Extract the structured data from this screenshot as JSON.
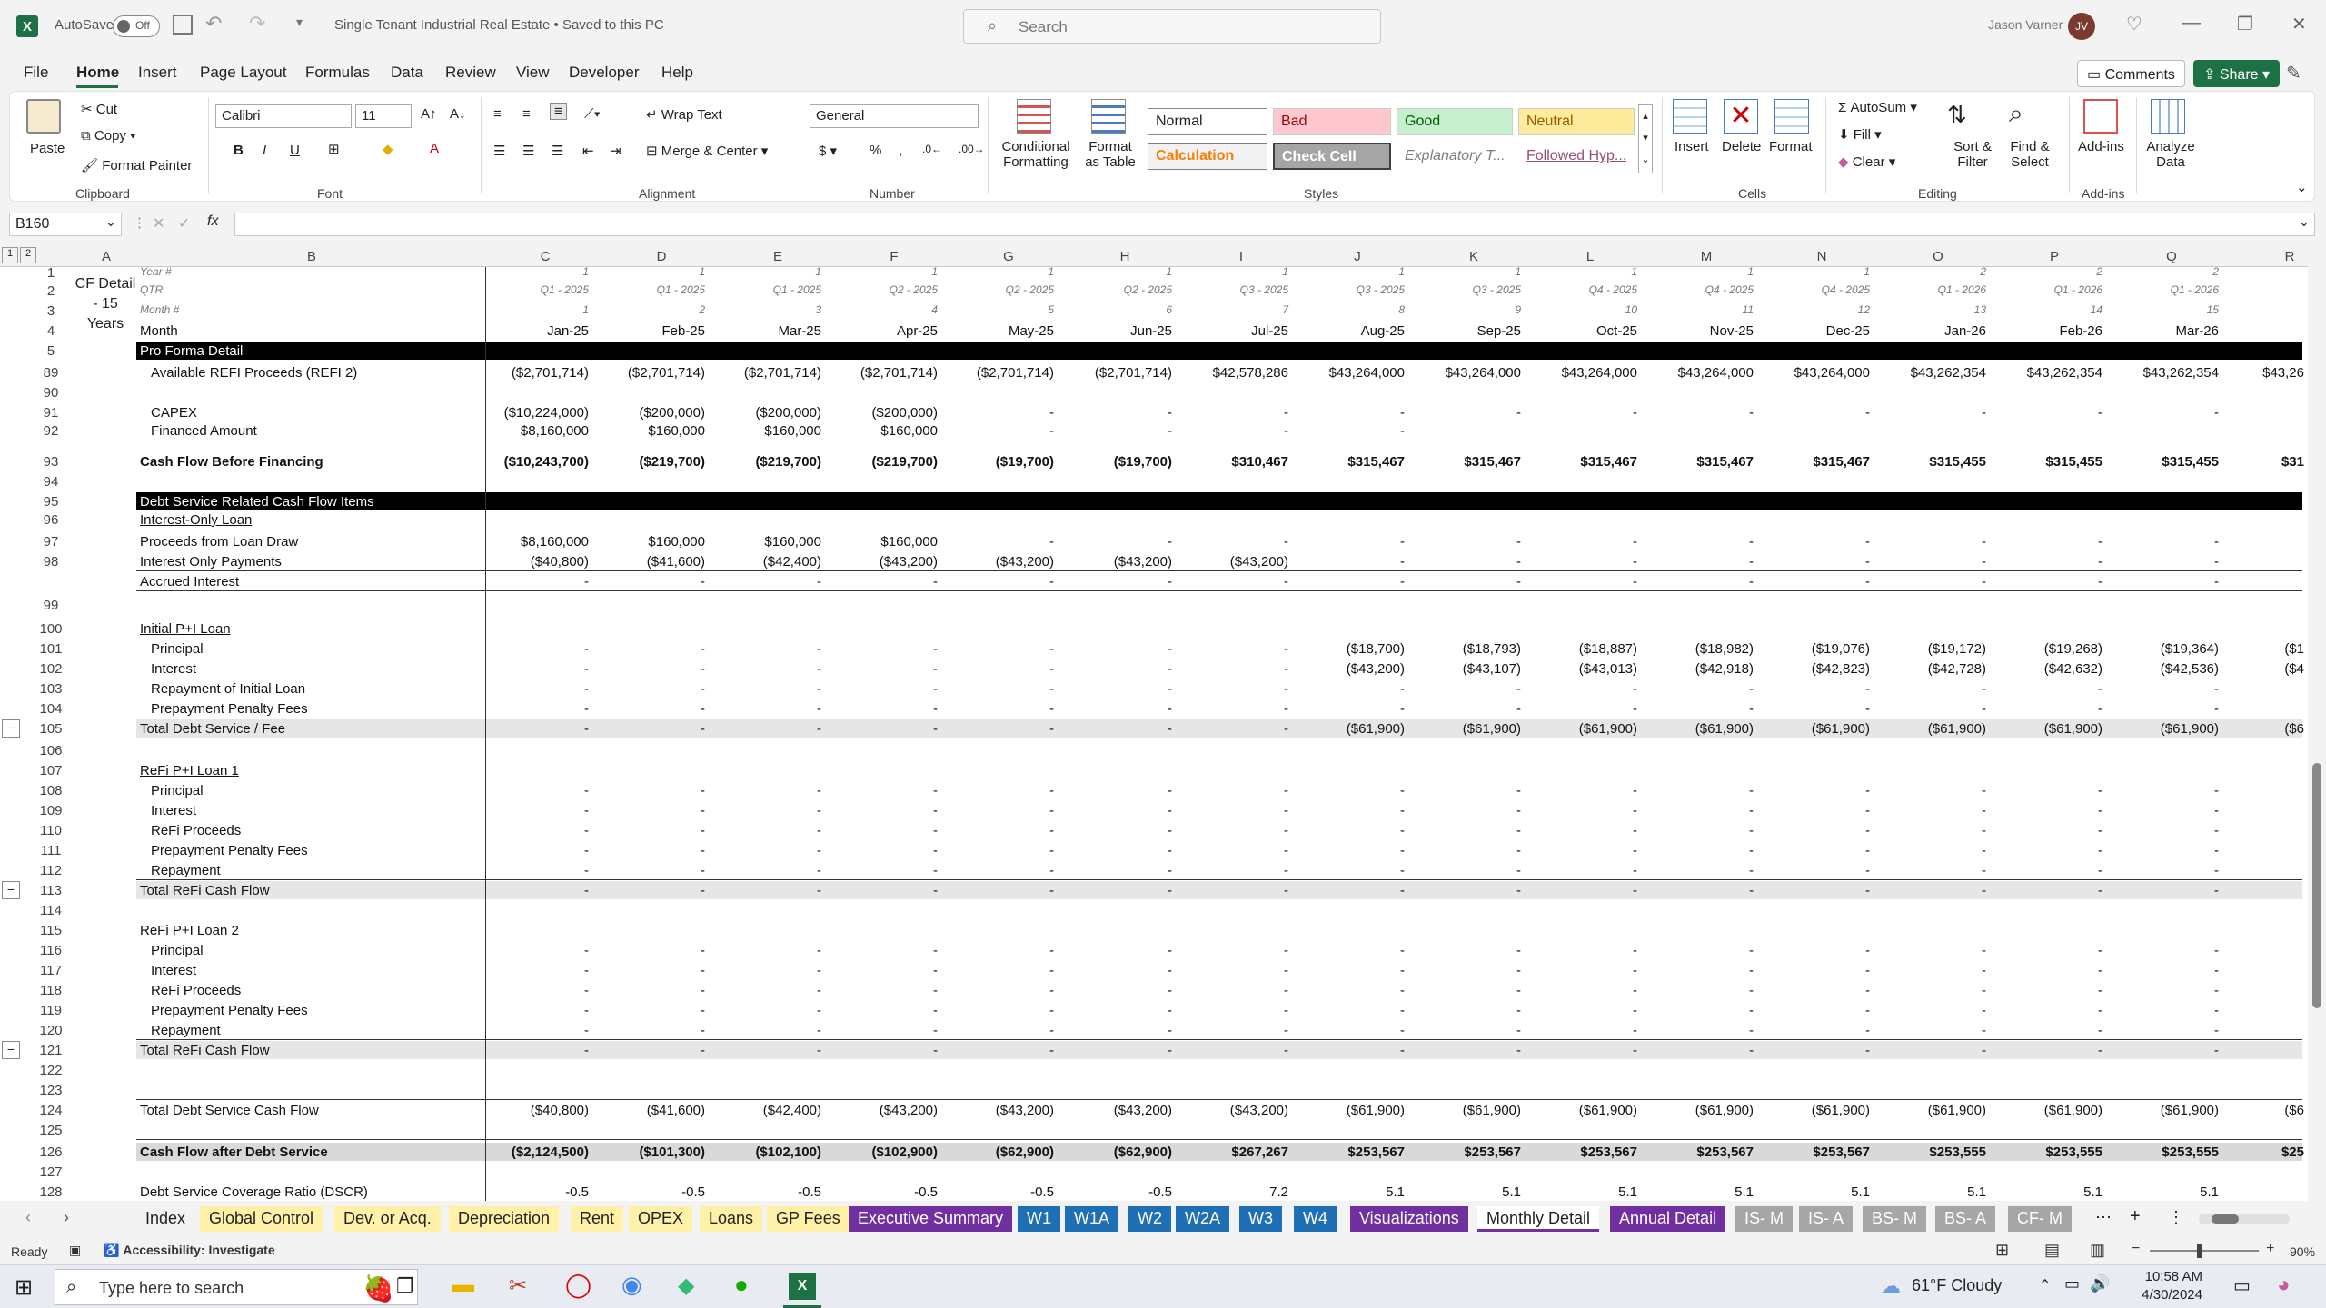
{
  "titlebar": {
    "autosave_label": "AutoSave",
    "autosave_state": "Off",
    "doc_title": "Single Tenant Industrial Real Estate • Saved to this PC",
    "search_placeholder": "Search",
    "user_name": "Jason Varner",
    "user_initials": "JV"
  },
  "menu": [
    "File",
    "Home",
    "Insert",
    "Page Layout",
    "Formulas",
    "Data",
    "Review",
    "View",
    "Developer",
    "Help"
  ],
  "menu_active": "Home",
  "comments_label": "Comments",
  "share_label": "Share",
  "ribbon": {
    "clipboard": {
      "paste": "Paste",
      "cut": "Cut",
      "copy": "Copy",
      "format_painter": "Format Painter",
      "group": "Clipboard"
    },
    "font": {
      "name": "Calibri",
      "size": "11",
      "group": "Font"
    },
    "alignment": {
      "wrap": "Wrap Text",
      "merge": "Merge & Center",
      "group": "Alignment"
    },
    "number": {
      "format": "General",
      "group": "Number"
    },
    "styles": {
      "conditional": "Conditional Formatting",
      "format_table": "Format as Table",
      "cells": [
        "Normal",
        "Bad",
        "Good",
        "Neutral",
        "Calculation",
        "Check Cell",
        "Explanatory T...",
        "Followed Hyp..."
      ],
      "group": "Styles"
    },
    "cells": {
      "insert": "Insert",
      "delete": "Delete",
      "format": "Format",
      "group": "Cells"
    },
    "editing": {
      "autosum": "AutoSum",
      "fill": "Fill",
      "clear": "Clear",
      "sort": "Sort & Filter",
      "find": "Find & Select",
      "group": "Editing"
    },
    "addins": {
      "addins": "Add-ins",
      "analyze": "Analyze Data",
      "group": "Add-ins"
    }
  },
  "formula": {
    "namebox": "B160",
    "fx": "fx",
    "content": ""
  },
  "columns": [
    "A",
    "B",
    "C",
    "D",
    "E",
    "F",
    "G",
    "H",
    "I",
    "J",
    "K",
    "L",
    "M",
    "N",
    "O",
    "P",
    "Q",
    "R"
  ],
  "sheet_title_a": "CF Detail - 15 Years",
  "header_rows": {
    "year": {
      "label": "Year #",
      "values": [
        "1",
        "1",
        "1",
        "1",
        "1",
        "1",
        "1",
        "1",
        "1",
        "1",
        "1",
        "1",
        "2",
        "2",
        "2"
      ]
    },
    "qtr": {
      "label": "QTR.",
      "values": [
        "Q1 - 2025",
        "Q1 - 2025",
        "Q1 - 2025",
        "Q2 - 2025",
        "Q2 - 2025",
        "Q2 - 2025",
        "Q3 - 2025",
        "Q3 - 2025",
        "Q3 - 2025",
        "Q4 - 2025",
        "Q4 - 2025",
        "Q4 - 2025",
        "Q1 - 2026",
        "Q1 - 2026",
        "Q1 - 2026"
      ]
    },
    "month_num": {
      "label": "Month #",
      "values": [
        "1",
        "2",
        "3",
        "4",
        "5",
        "6",
        "7",
        "8",
        "9",
        "10",
        "11",
        "12",
        "13",
        "14",
        "15"
      ]
    },
    "month": {
      "label": "Month",
      "values": [
        "Jan-25",
        "Feb-25",
        "Mar-25",
        "Apr-25",
        "May-25",
        "Jun-25",
        "Jul-25",
        "Aug-25",
        "Sep-25",
        "Oct-25",
        "Nov-25",
        "Dec-25",
        "Jan-26",
        "Feb-26",
        "Mar-26"
      ]
    }
  },
  "rows": [
    {
      "n": "1"
    },
    {
      "n": "2"
    },
    {
      "n": "3"
    },
    {
      "n": "4"
    },
    {
      "n": "5",
      "label": "Pro Forma Detail"
    },
    {
      "n": "89",
      "label": "Available REFI Proceeds (REFI 2)",
      "values": [
        "($2,701,714)",
        "($2,701,714)",
        "($2,701,714)",
        "($2,701,714)",
        "($2,701,714)",
        "($2,701,714)",
        "$42,578,286",
        "$43,264,000",
        "$43,264,000",
        "$43,264,000",
        "$43,264,000",
        "$43,264,000",
        "$43,262,354",
        "$43,262,354",
        "$43,262,354",
        "$43,26"
      ]
    },
    {
      "n": "90"
    },
    {
      "n": "91",
      "label": "CAPEX",
      "values": [
        "($10,224,000)",
        "($200,000)",
        "($200,000)",
        "($200,000)",
        "-",
        "-",
        "-",
        "-",
        "-",
        "-",
        "-",
        "-",
        "-",
        "-",
        "-",
        ""
      ]
    },
    {
      "n": "92",
      "label": "Financed Amount",
      "values": [
        "$8,160,000",
        "$160,000",
        "$160,000",
        "$160,000",
        "-",
        "-",
        "-",
        "-",
        "",
        "",
        "",
        "",
        "",
        "",
        "",
        ""
      ]
    },
    {
      "n": "93",
      "label": "Cash Flow Before Financing",
      "values": [
        "($10,243,700)",
        "($219,700)",
        "($219,700)",
        "($219,700)",
        "($19,700)",
        "($19,700)",
        "$310,467",
        "$315,467",
        "$315,467",
        "$315,467",
        "$315,467",
        "$315,467",
        "$315,455",
        "$315,455",
        "$315,455",
        "$31"
      ]
    },
    {
      "n": "94"
    },
    {
      "n": "95",
      "label": "Debt Service Related Cash Flow Items"
    },
    {
      "n": "96",
      "label": "Interest-Only Loan"
    },
    {
      "n": "97",
      "label": "Proceeds from Loan Draw",
      "values": [
        "$8,160,000",
        "$160,000",
        "$160,000",
        "$160,000",
        "-",
        "-",
        "-",
        "-",
        "-",
        "-",
        "-",
        "-",
        "-",
        "-",
        "-",
        ""
      ]
    },
    {
      "n": "98",
      "label": "Interest Only Payments",
      "values": [
        "($40,800)",
        "($41,600)",
        "($42,400)",
        "($43,200)",
        "($43,200)",
        "($43,200)",
        "($43,200)",
        "-",
        "-",
        "-",
        "-",
        "-",
        "-",
        "-",
        "-",
        ""
      ]
    },
    {
      "n": "",
      "label": "Accrued Interest",
      "values": [
        "-",
        "-",
        "-",
        "-",
        "-",
        "-",
        "-",
        "-",
        "-",
        "-",
        "-",
        "-",
        "-",
        "-",
        "-",
        ""
      ]
    },
    {
      "n": "99"
    },
    {
      "n": "100",
      "label": "Initial P+I Loan"
    },
    {
      "n": "101",
      "label": "Principal",
      "values": [
        "-",
        "-",
        "-",
        "-",
        "-",
        "-",
        "-",
        "($18,700)",
        "($18,793)",
        "($18,887)",
        "($18,982)",
        "($19,076)",
        "($19,172)",
        "($19,268)",
        "($19,364)",
        "($1"
      ]
    },
    {
      "n": "102",
      "label": "Interest",
      "values": [
        "-",
        "-",
        "-",
        "-",
        "-",
        "-",
        "-",
        "($43,200)",
        "($43,107)",
        "($43,013)",
        "($42,918)",
        "($42,823)",
        "($42,728)",
        "($42,632)",
        "($42,536)",
        "($4"
      ]
    },
    {
      "n": "103",
      "label": "Repayment of Initial Loan",
      "values": [
        "-",
        "-",
        "-",
        "-",
        "-",
        "-",
        "-",
        "-",
        "-",
        "-",
        "-",
        "-",
        "-",
        "-",
        "-",
        ""
      ]
    },
    {
      "n": "104",
      "label": "Prepayment Penalty Fees",
      "values": [
        "-",
        "-",
        "-",
        "-",
        "-",
        "-",
        "-",
        "-",
        "-",
        "-",
        "-",
        "-",
        "-",
        "-",
        "-",
        ""
      ]
    },
    {
      "n": "105",
      "label": "Total Debt Service / Fee",
      "values": [
        "-",
        "-",
        "-",
        "-",
        "-",
        "-",
        "-",
        "($61,900)",
        "($61,900)",
        "($61,900)",
        "($61,900)",
        "($61,900)",
        "($61,900)",
        "($61,900)",
        "($61,900)",
        "($6"
      ]
    },
    {
      "n": "106"
    },
    {
      "n": "107",
      "label": "ReFi P+I Loan 1"
    },
    {
      "n": "108",
      "label": "Principal",
      "values": [
        "-",
        "-",
        "-",
        "-",
        "-",
        "-",
        "-",
        "-",
        "-",
        "-",
        "-",
        "-",
        "-",
        "-",
        "-",
        ""
      ]
    },
    {
      "n": "109",
      "label": "Interest",
      "values": [
        "-",
        "-",
        "-",
        "-",
        "-",
        "-",
        "-",
        "-",
        "-",
        "-",
        "-",
        "-",
        "-",
        "-",
        "-",
        ""
      ]
    },
    {
      "n": "110",
      "label": "ReFi Proceeds",
      "values": [
        "-",
        "-",
        "-",
        "-",
        "-",
        "-",
        "-",
        "-",
        "-",
        "-",
        "-",
        "-",
        "-",
        "-",
        "-",
        ""
      ]
    },
    {
      "n": "111",
      "label": "Prepayment Penalty Fees",
      "values": [
        "-",
        "-",
        "-",
        "-",
        "-",
        "-",
        "-",
        "-",
        "-",
        "-",
        "-",
        "-",
        "-",
        "-",
        "-",
        ""
      ]
    },
    {
      "n": "112",
      "label": "Repayment",
      "values": [
        "-",
        "-",
        "-",
        "-",
        "-",
        "-",
        "-",
        "-",
        "-",
        "-",
        "-",
        "-",
        "-",
        "-",
        "-",
        ""
      ]
    },
    {
      "n": "113",
      "label": "Total ReFi Cash Flow",
      "values": [
        "-",
        "-",
        "-",
        "-",
        "-",
        "-",
        "-",
        "-",
        "-",
        "-",
        "-",
        "-",
        "-",
        "-",
        "-",
        ""
      ]
    },
    {
      "n": "114"
    },
    {
      "n": "115",
      "label": "ReFi P+I Loan 2"
    },
    {
      "n": "116",
      "label": "Principal",
      "values": [
        "-",
        "-",
        "-",
        "-",
        "-",
        "-",
        "-",
        "-",
        "-",
        "-",
        "-",
        "-",
        "-",
        "-",
        "-",
        ""
      ]
    },
    {
      "n": "117",
      "label": "Interest",
      "values": [
        "-",
        "-",
        "-",
        "-",
        "-",
        "-",
        "-",
        "-",
        "-",
        "-",
        "-",
        "-",
        "-",
        "-",
        "-",
        ""
      ]
    },
    {
      "n": "118",
      "label": "ReFi Proceeds",
      "values": [
        "-",
        "-",
        "-",
        "-",
        "-",
        "-",
        "-",
        "-",
        "-",
        "-",
        "-",
        "-",
        "-",
        "-",
        "-",
        ""
      ]
    },
    {
      "n": "119",
      "label": "Prepayment Penalty Fees",
      "values": [
        "-",
        "-",
        "-",
        "-",
        "-",
        "-",
        "-",
        "-",
        "-",
        "-",
        "-",
        "-",
        "-",
        "-",
        "-",
        ""
      ]
    },
    {
      "n": "120",
      "label": "Repayment",
      "values": [
        "-",
        "-",
        "-",
        "-",
        "-",
        "-",
        "-",
        "-",
        "-",
        "-",
        "-",
        "-",
        "-",
        "-",
        "-",
        ""
      ]
    },
    {
      "n": "121",
      "label": "Total ReFi Cash Flow",
      "values": [
        "-",
        "-",
        "-",
        "-",
        "-",
        "-",
        "-",
        "-",
        "-",
        "-",
        "-",
        "-",
        "-",
        "-",
        "-",
        ""
      ]
    },
    {
      "n": "122"
    },
    {
      "n": "123"
    },
    {
      "n": "124",
      "label": "Total Debt Service Cash Flow",
      "values": [
        "($40,800)",
        "($41,600)",
        "($42,400)",
        "($43,200)",
        "($43,200)",
        "($43,200)",
        "($43,200)",
        "($61,900)",
        "($61,900)",
        "($61,900)",
        "($61,900)",
        "($61,900)",
        "($61,900)",
        "($61,900)",
        "($61,900)",
        "($6"
      ]
    },
    {
      "n": "125"
    },
    {
      "n": "126",
      "label": "Cash Flow after Debt Service",
      "values": [
        "($2,124,500)",
        "($101,300)",
        "($102,100)",
        "($102,900)",
        "($62,900)",
        "($62,900)",
        "$267,267",
        "$253,567",
        "$253,567",
        "$253,567",
        "$253,567",
        "$253,567",
        "$253,555",
        "$253,555",
        "$253,555",
        "$25"
      ]
    },
    {
      "n": "127"
    },
    {
      "n": "128",
      "label": "Debt Service Coverage Ratio (DSCR)",
      "values": [
        "-0.5",
        "-0.5",
        "-0.5",
        "-0.5",
        "-0.5",
        "-0.5",
        "7.2",
        "5.1",
        "5.1",
        "5.1",
        "5.1",
        "5.1",
        "5.1",
        "5.1",
        "5.1",
        ""
      ]
    }
  ],
  "tabs": [
    {
      "name": "Index",
      "style": "none"
    },
    {
      "name": "Global Control",
      "style": "yellow"
    },
    {
      "name": "Dev. or Acq.",
      "style": "yellow"
    },
    {
      "name": "Depreciation",
      "style": "yellow"
    },
    {
      "name": "Rent",
      "style": "yellow"
    },
    {
      "name": "OPEX",
      "style": "yellow"
    },
    {
      "name": "Loans",
      "style": "yellow"
    },
    {
      "name": "GP Fees",
      "style": "yellow"
    },
    {
      "name": "Executive Summary",
      "style": "purple"
    },
    {
      "name": "W1",
      "style": "blue"
    },
    {
      "name": "W1A",
      "style": "blue"
    },
    {
      "name": "W2",
      "style": "blue"
    },
    {
      "name": "W2A",
      "style": "blue"
    },
    {
      "name": "W3",
      "style": "blue"
    },
    {
      "name": "W4",
      "style": "blue"
    },
    {
      "name": "Visualizations",
      "style": "purple"
    },
    {
      "name": "Monthly Detail",
      "style": "active"
    },
    {
      "name": "Annual Detail",
      "style": "purple"
    },
    {
      "name": "IS- M",
      "style": "gray"
    },
    {
      "name": "IS- A",
      "style": "gray"
    },
    {
      "name": "BS- M",
      "style": "gray"
    },
    {
      "name": "BS- A",
      "style": "gray"
    },
    {
      "name": "CF- M",
      "style": "gray"
    }
  ],
  "status": {
    "ready": "Ready",
    "accessibility": "Accessibility: Investigate",
    "zoom": "90%"
  },
  "taskbar": {
    "search_placeholder": "Type here to search",
    "weather": "61°F Cloudy",
    "time": "10:58 AM",
    "date": "4/30/2024"
  }
}
